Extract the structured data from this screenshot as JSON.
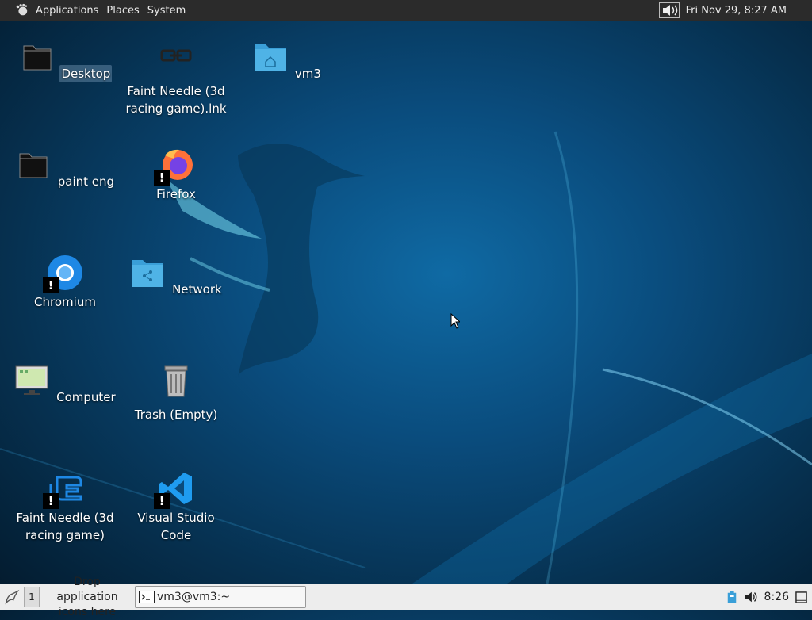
{
  "top_panel": {
    "menus": [
      "Applications",
      "Places",
      "System"
    ],
    "clock": "Fri Nov 29,  8:27 AM"
  },
  "desktop_icons": {
    "desktop": "Desktop",
    "faint_needle_lnk": "Faint Needle (3d racing game).lnk",
    "vm3": "vm3",
    "paint_eng": "paint eng",
    "firefox": "Firefox",
    "chromium": "Chromium",
    "network": "Network",
    "computer": "Computer",
    "trash": "Trash (Empty)",
    "faint_needle": "Faint Needle (3d racing game)",
    "vscode": "Visual Studio Code",
    "badge": "!"
  },
  "bottom_panel": {
    "workspace": "1",
    "drop_hint": "Drop application icons here",
    "task_label": "vm3@vm3:~",
    "tray_clock": "8:26"
  },
  "colors": {
    "panel_top": "#2b2b2b",
    "panel_bottom": "#ededed",
    "folder_blue": "#3a9fd8"
  }
}
